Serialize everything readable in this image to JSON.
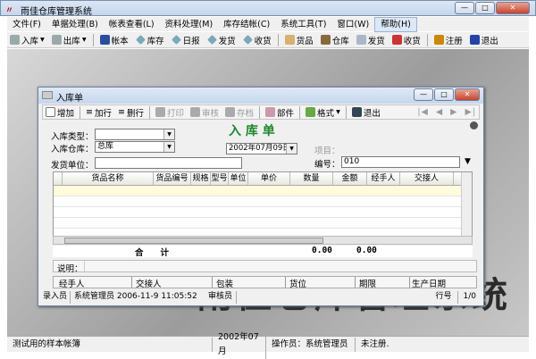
{
  "app": {
    "title": "雨佳仓库管理系统"
  },
  "menu": [
    "文件(F)",
    "单据处理(B)",
    "帐表查看(L)",
    "资料处理(M)",
    "库存结帐(C)",
    "系统工具(T)",
    "窗口(W)",
    "帮助(H)"
  ],
  "toolbar": [
    "入库",
    "出库",
    "帐本",
    "库存",
    "日报",
    "发货",
    "收货",
    "货品",
    "仓库",
    "发货",
    "收货",
    "注册",
    "退出"
  ],
  "background_text": "雨佳仓库管理系统",
  "child": {
    "title": "入库单",
    "toolbar": {
      "add": "增加",
      "add_row": "加行",
      "del_row": "删行",
      "print": "打印",
      "audit": "审核",
      "save": "存档",
      "parts": "部件",
      "format": "格式",
      "exit": "退出"
    },
    "heading": "入 库 单",
    "form": {
      "type_label": "入库类型：",
      "type_value": "",
      "warehouse_label": "入库仓库：",
      "warehouse_value": "总库",
      "supplier_label": "发货单位：",
      "supplier_value": "",
      "date_value": "2002年07月09日",
      "project_label": "项目：",
      "number_label": "编号：",
      "number_value": "010"
    },
    "grid": {
      "columns": [
        "货品名称",
        "货品编号",
        "规格",
        "型号",
        "单位",
        "单价",
        "数量",
        "金额",
        "经手人",
        "交接人"
      ],
      "total_label": "合　　计",
      "total_qty": "0.00",
      "total_amount": "0.00"
    },
    "note_label": "说明：",
    "bottom_fields": [
      "经手人",
      "交接人",
      "包装",
      "货位",
      "期限",
      "生产日期"
    ],
    "status": {
      "entry_label": "录入员",
      "entry_value": "系统管理员 2006-11-9 11:05:52",
      "auditor_label": "审核员",
      "row_label": "行号",
      "row_value": "1/0"
    }
  },
  "statusbar": [
    "测试用的样本帐簿",
    "2002年07月",
    "操作员：系统管理员",
    "未注册."
  ]
}
